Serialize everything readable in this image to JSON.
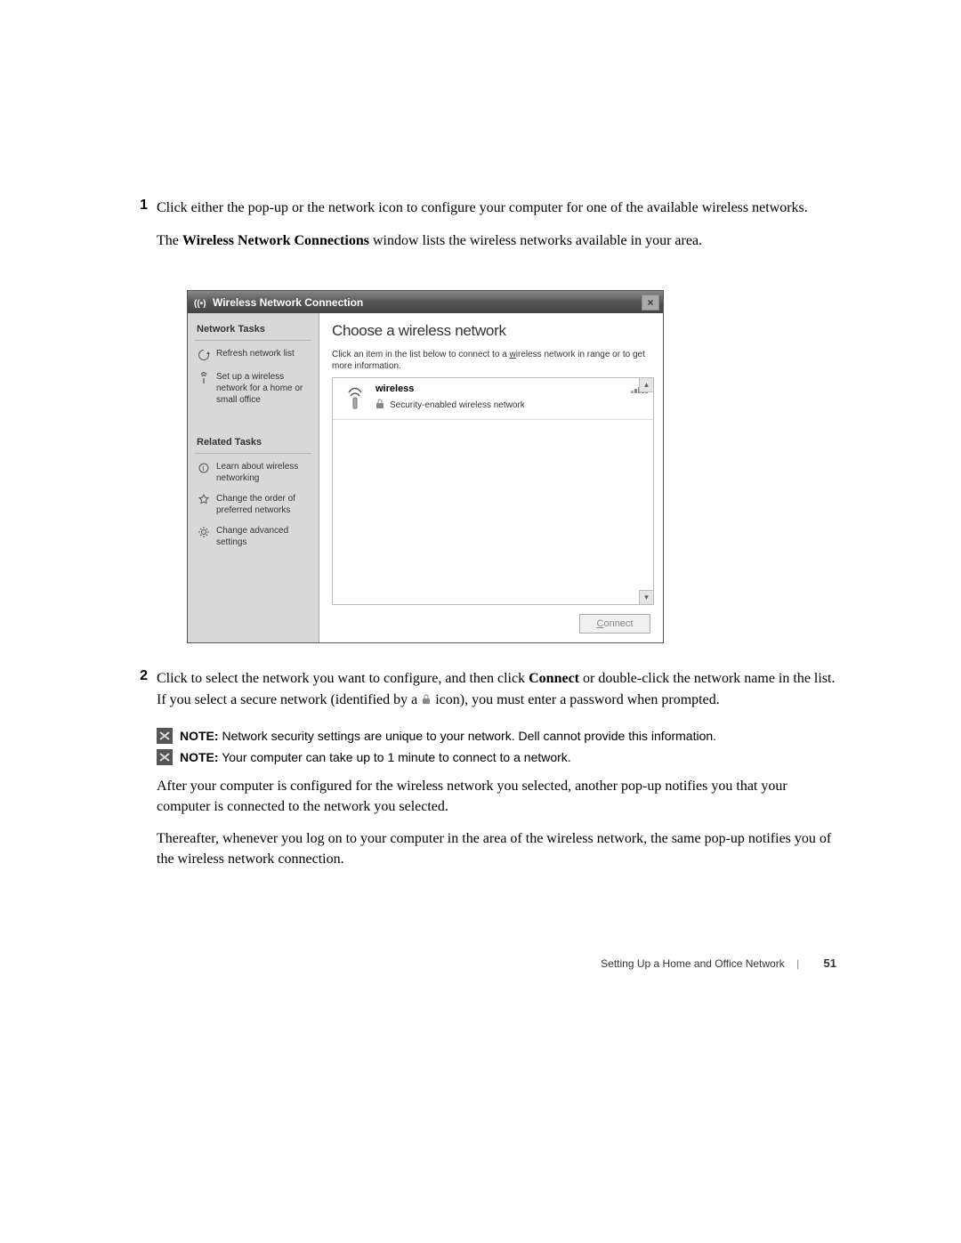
{
  "steps": {
    "s1_num": "1",
    "s1_text": "Click either the pop-up or the network icon to configure your computer for one of the available wireless networks.",
    "s1_para2_a": "The ",
    "s1_para2_bold": "Wireless Network Connections",
    "s1_para2_b": " window lists the wireless networks available in your area.",
    "s2_num": "2",
    "s2_text_a": "Click to select the network you want to configure, and then click ",
    "s2_text_bold": "Connect",
    "s2_text_b": " or double-click the network name in the list. If you select a secure network (identified by a ",
    "s2_text_c": " icon), you must enter a password when prompted."
  },
  "window": {
    "title": "Wireless Network Connection",
    "close": "×",
    "sidebar": {
      "section1": "Network Tasks",
      "refresh": "Refresh network list",
      "setup": "Set up a wireless network for a home or small office",
      "section2": "Related Tasks",
      "learn": "Learn about wireless networking",
      "order": "Change the order of preferred networks",
      "advanced": "Change advanced settings"
    },
    "panel": {
      "heading": "Choose a wireless network",
      "sub_a": "Click an item in the list below to connect to a ",
      "sub_b": "w",
      "sub_c": "ireless network in range or to get more information.",
      "net_name": "wireless",
      "net_security": "Security-enabled wireless network",
      "scroll_up": "▴",
      "scroll_down": "▾",
      "connect_a": "C",
      "connect_b": "onnect"
    }
  },
  "notes": {
    "label1": "NOTE:",
    "text1": " Network security settings are unique to your network. Dell cannot provide this information.",
    "label2": "NOTE:",
    "text2": " Your computer can take up to 1 minute to connect to a network."
  },
  "paras": {
    "p1": "After your computer is configured for the wireless network you selected, another pop-up notifies you that your computer is connected to the network you selected.",
    "p2": "Thereafter, whenever you log on to your computer in the area of the wireless network, the same pop-up notifies you of the wireless network connection."
  },
  "footer": {
    "section": "Setting Up a Home and Office Network",
    "page": "51"
  }
}
